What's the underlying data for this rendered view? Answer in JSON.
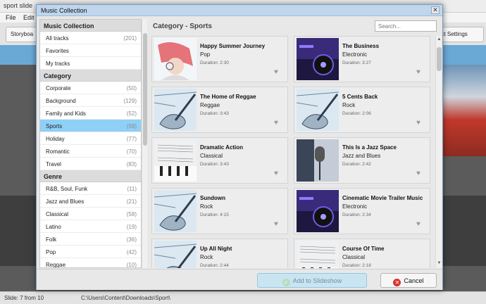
{
  "app": {
    "title": "sport slide",
    "menu": [
      "File",
      "Edit"
    ],
    "toolbar_left_label": "Storyboa",
    "toolbar_right_label": "ect Settings",
    "status_left": "Slide: 7 from 10",
    "status_path": "C:\\Users\\Content\\Downloads\\Sport\\"
  },
  "dialog": {
    "title": "Music Collection",
    "close_symbol": "✕"
  },
  "sidebar": {
    "sections": [
      {
        "header": "Music Collection",
        "items": [
          {
            "label": "All tracks",
            "count": "(201)"
          },
          {
            "label": "Favorites",
            "count": ""
          },
          {
            "label": "My tracks",
            "count": ""
          }
        ]
      },
      {
        "header": "Category",
        "items": [
          {
            "label": "Corporate",
            "count": "(50)"
          },
          {
            "label": "Background",
            "count": "(129)"
          },
          {
            "label": "Family and Kids",
            "count": "(52)"
          },
          {
            "label": "Sports",
            "count": "(59)",
            "selected": true
          },
          {
            "label": "Holiday",
            "count": "(77)"
          },
          {
            "label": "Romantic",
            "count": "(70)"
          },
          {
            "label": "Travel",
            "count": "(83)"
          }
        ]
      },
      {
        "header": "Genre",
        "items": [
          {
            "label": "R&B, Soul, Funk",
            "count": "(11)"
          },
          {
            "label": "Jazz and Blues",
            "count": "(21)"
          },
          {
            "label": "Classical",
            "count": "(58)"
          },
          {
            "label": "Latino",
            "count": "(19)"
          },
          {
            "label": "Folk",
            "count": "(36)"
          },
          {
            "label": "Pop",
            "count": "(42)"
          },
          {
            "label": "Reggae",
            "count": "(10)"
          }
        ]
      }
    ]
  },
  "main": {
    "category_title": "Category - Sports",
    "search_placeholder": "Search...",
    "tracks": [
      {
        "title": "Happy Summer Journey",
        "genre": "Pop",
        "duration": "Duration: 2:30",
        "thumb": "headphones-girl"
      },
      {
        "title": "The Business",
        "genre": "Electronic",
        "duration": "Duration: 3:27",
        "thumb": "dj-deck"
      },
      {
        "title": "The Home of Reggae",
        "genre": "Reggae",
        "duration": "Duration: 3:43",
        "thumb": "guitar-sketch"
      },
      {
        "title": "5 Cents Back",
        "genre": "Rock",
        "duration": "Duration: 2:06",
        "thumb": "guitar-sketch"
      },
      {
        "title": "Dramatic Action",
        "genre": "Classical",
        "duration": "Duration: 3:43",
        "thumb": "sheet-music"
      },
      {
        "title": "This Is a Jazz Space",
        "genre": "Jazz and Blues",
        "duration": "Duration: 2:42",
        "thumb": "microphone"
      },
      {
        "title": "Sundown",
        "genre": "Rock",
        "duration": "Duration: 4:15",
        "thumb": "guitar-sketch"
      },
      {
        "title": "Cinematic Movie Trailer Music",
        "genre": "Electronic",
        "duration": "Duration: 2:34",
        "thumb": "dj-deck"
      },
      {
        "title": "Up All Night",
        "genre": "Rock",
        "duration": "Duration: 2:44",
        "thumb": "guitar-sketch"
      },
      {
        "title": "Course Of Time",
        "genre": "Classical",
        "duration": "Duration: 2:18",
        "thumb": "sheet-music"
      }
    ]
  },
  "footer": {
    "add_label": "Add to Slideshow",
    "cancel_label": "Cancel"
  },
  "colors": {
    "selected_item": "#8fd0f7",
    "dialog_title_bar": "#bfd6ec",
    "add_button": "#c9e5f1",
    "cancel_icon": "#d9352b"
  }
}
